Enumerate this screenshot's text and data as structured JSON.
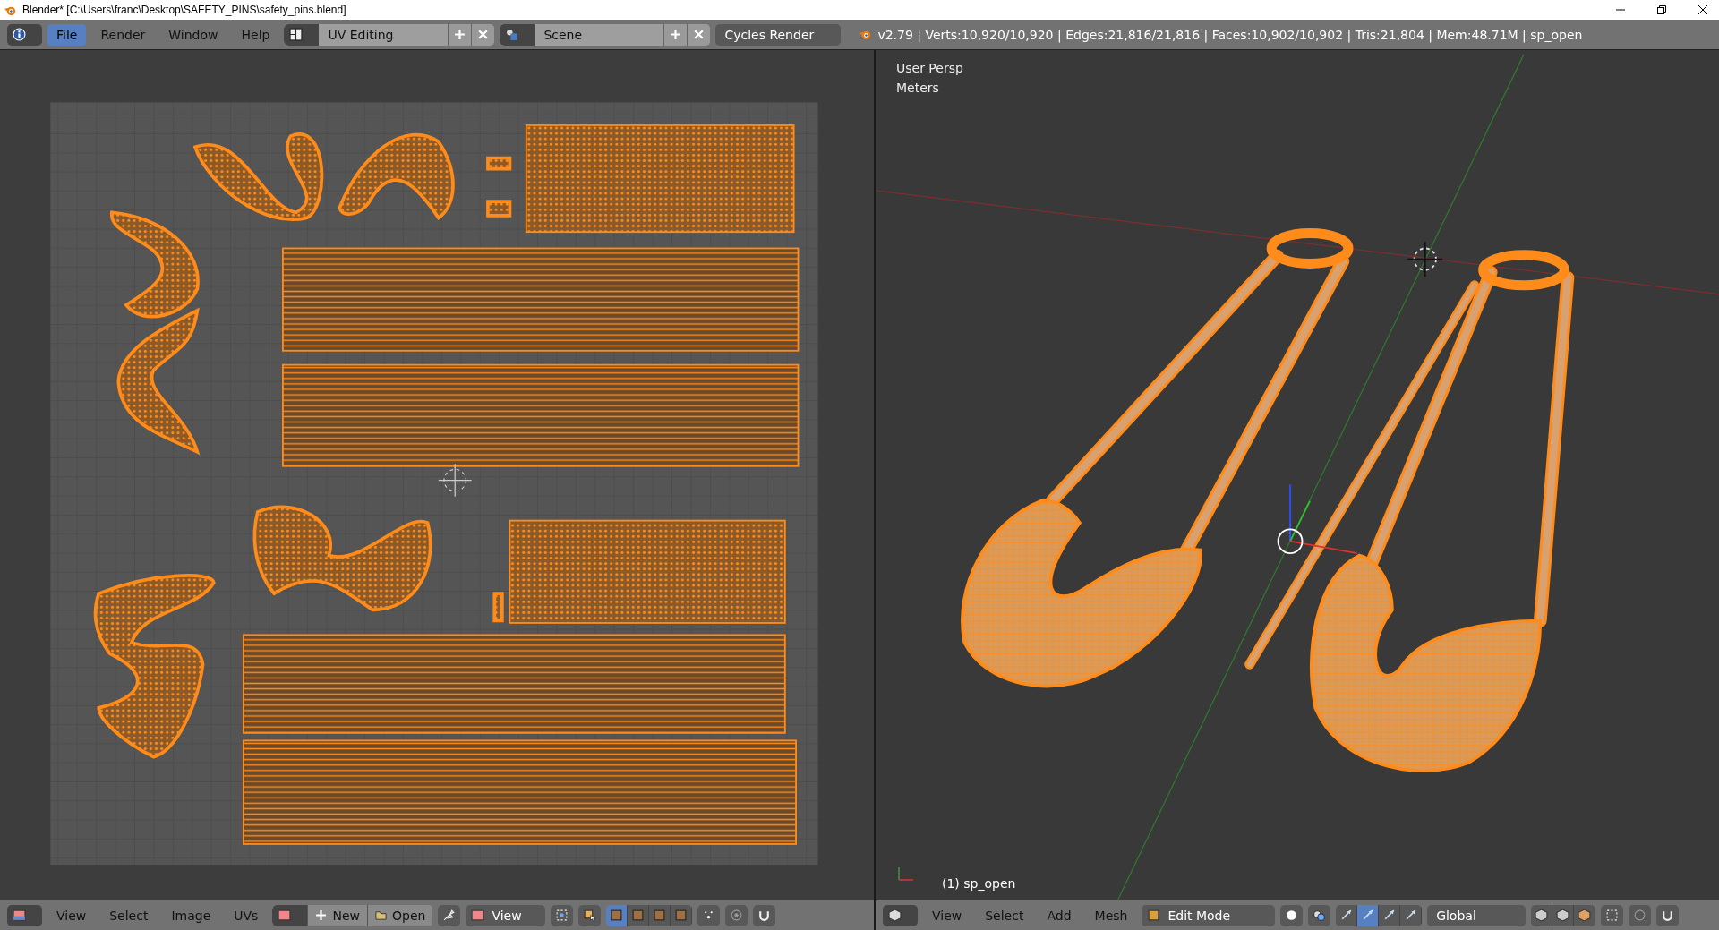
{
  "window": {
    "title": "Blender* [C:\\Users\\franc\\Desktop\\SAFETY_PINS\\safety_pins.blend]"
  },
  "info_header": {
    "menus": [
      {
        "label": "File",
        "selected": true
      },
      {
        "label": "Render",
        "selected": false
      },
      {
        "label": "Window",
        "selected": false
      },
      {
        "label": "Help",
        "selected": false
      }
    ],
    "layout": "UV Editing",
    "scene": "Scene",
    "engine": "Cycles Render",
    "stats": "v2.79 | Verts:10,920/10,920 | Edges:21,816/21,816 | Faces:10,902/10,902 | Tris:21,804 | Mem:48.71M | sp_open"
  },
  "uv_editor": {
    "header": {
      "menus": [
        "View",
        "Select",
        "Image",
        "UVs"
      ],
      "new_button": "New",
      "open_button": "Open",
      "view_dropdown": "View",
      "select_modes": [
        {
          "selected": true
        },
        {
          "selected": false
        },
        {
          "selected": false
        },
        {
          "selected": false
        }
      ]
    }
  },
  "viewport": {
    "view_name": "User Persp",
    "units": "Meters",
    "object_label": "(1) sp_open",
    "header": {
      "menus": [
        "View",
        "Select",
        "Add",
        "Mesh"
      ],
      "mode": "Edit Mode",
      "manipulators": [
        {
          "selected": false
        },
        {
          "selected": true
        },
        {
          "selected": false
        },
        {
          "selected": false
        }
      ],
      "orientation": "Global"
    }
  }
}
